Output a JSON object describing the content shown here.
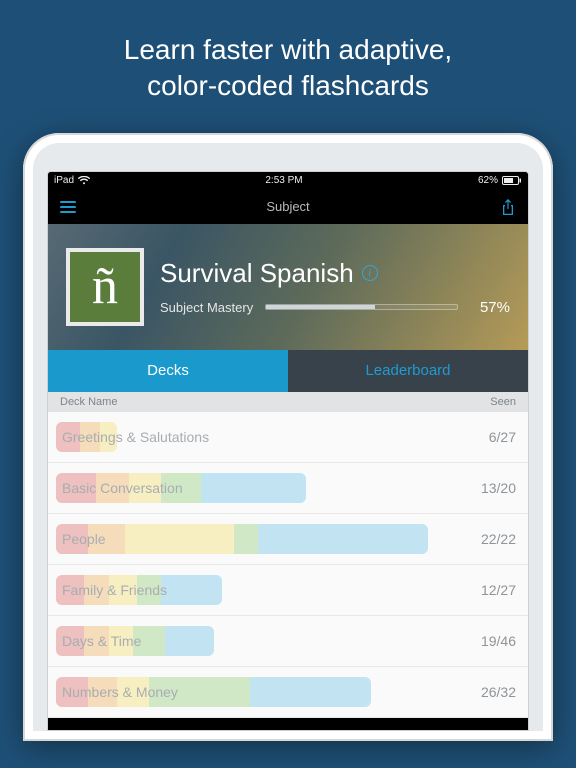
{
  "promo": {
    "headline": "Learn faster with adaptive,\ncolor-coded flashcards"
  },
  "statusbar": {
    "device": "iPad",
    "time": "2:53 PM",
    "battery": "62%"
  },
  "navbar": {
    "title": "Subject"
  },
  "subject": {
    "logo_letter": "ñ",
    "title": "Survival Spanish",
    "mastery_label": "Subject Mastery",
    "mastery_pct": "57%",
    "mastery_fill_pct": 57
  },
  "tabs": {
    "decks": "Decks",
    "leaderboard": "Leaderboard"
  },
  "deck_header": {
    "name": "Deck Name",
    "seen": "Seen"
  },
  "decks": [
    {
      "name": "Greetings & Salutations",
      "seen": "6/27",
      "segs": [
        6,
        5,
        4,
        0,
        0
      ]
    },
    {
      "name": "Basic Conversation",
      "seen": "13/20",
      "segs": [
        10,
        8,
        8,
        10,
        26
      ]
    },
    {
      "name": "People",
      "seen": "22/22",
      "segs": [
        8,
        9,
        27,
        6,
        42
      ]
    },
    {
      "name": "Family & Friends",
      "seen": "12/27",
      "segs": [
        7,
        6,
        7,
        6,
        15
      ]
    },
    {
      "name": "Days & Time",
      "seen": "19/46",
      "segs": [
        7,
        6,
        6,
        8,
        12
      ]
    },
    {
      "name": "Numbers & Money",
      "seen": "26/32",
      "segs": [
        8,
        7,
        8,
        25,
        30
      ]
    }
  ]
}
